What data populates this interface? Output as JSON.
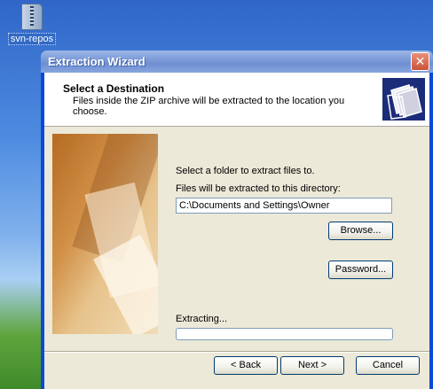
{
  "desktop": {
    "icon_label": "svn-repos",
    "icon_name": "zip-folder-icon"
  },
  "window": {
    "title": "Extraction Wizard",
    "close_glyph": "✕"
  },
  "header": {
    "title": "Select a Destination",
    "subtitle": "Files inside the ZIP archive will be extracted to the location you choose.",
    "icon_name": "folders-icon"
  },
  "content": {
    "select_label": "Select a folder to extract files to.",
    "dir_label": "Files will be extracted to this directory:",
    "dir_value": "C:\\Documents and Settings\\Owner",
    "browse_label": "Browse...",
    "password_label": "Password...",
    "extracting_label": "Extracting...",
    "progress": 0
  },
  "footer": {
    "back_label": "< Back",
    "next_label": "Next >",
    "cancel_label": "Cancel"
  }
}
